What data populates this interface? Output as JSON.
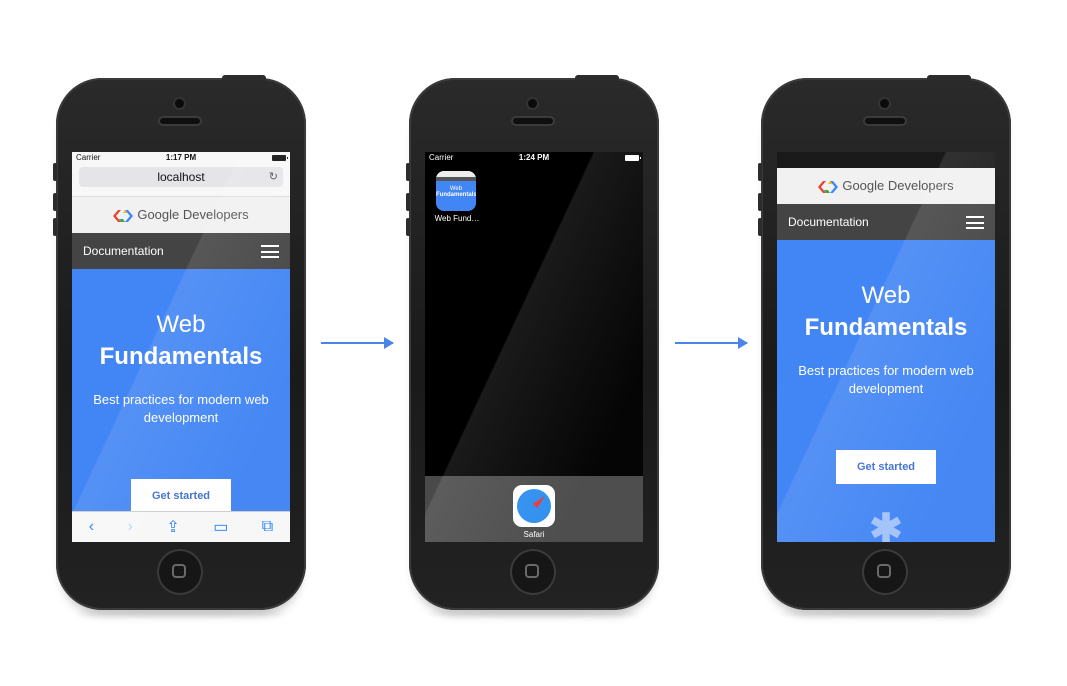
{
  "phone1": {
    "status": {
      "carrier": "Carrier",
      "time": "1:17 PM"
    },
    "url": "localhost",
    "brand": "Google Developers",
    "nav_label": "Documentation",
    "hero": {
      "line1": "Web",
      "line2": "Fundamentals",
      "subtitle": "Best practices for modern web development"
    },
    "cta": "Get started",
    "toolbar": [
      "back-icon",
      "forward-icon",
      "share-icon",
      "bookmarks-icon",
      "tabs-icon"
    ]
  },
  "phone2": {
    "status": {
      "carrier": "Carrier",
      "time": "1:24 PM"
    },
    "app_label": "Web Fund…",
    "icon_line1": "Web",
    "icon_line2": "Fundamentals",
    "dock_app": "Safari"
  },
  "phone3": {
    "brand": "Google Developers",
    "nav_label": "Documentation",
    "hero": {
      "line1": "Web",
      "line2": "Fundamentals",
      "subtitle": "Best practices for modern web development"
    },
    "cta": "Get started"
  },
  "colors": {
    "primary": "#4285f4",
    "nav": "#444444",
    "arrow": "#4a86e8"
  }
}
